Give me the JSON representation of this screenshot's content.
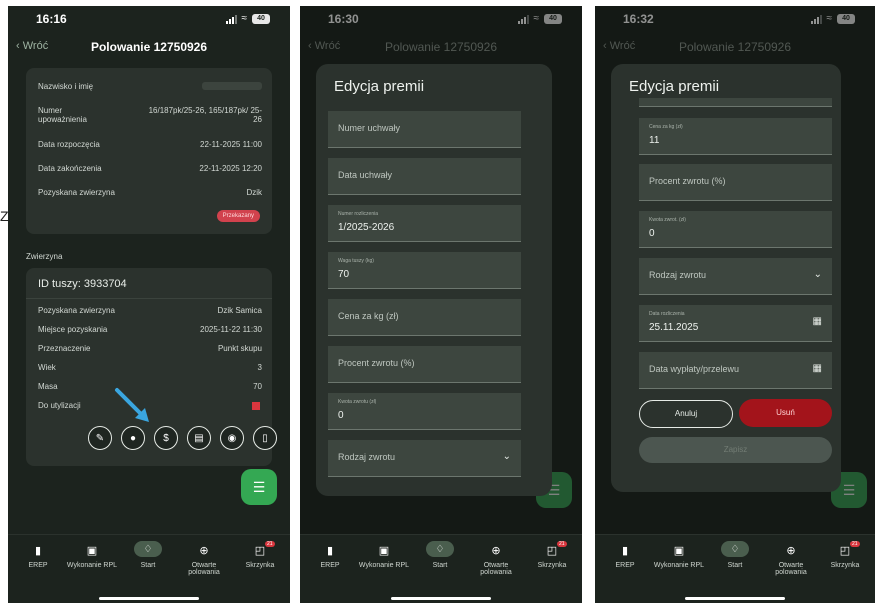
{
  "status": {
    "time1": "16:16",
    "time2": "16:30",
    "time3": "16:32",
    "battery": "40"
  },
  "nav": {
    "back": "Wróć",
    "title": "Polowanie 12750926"
  },
  "screen1": {
    "info": [
      {
        "k": "Nazwisko i imię",
        "v": ""
      },
      {
        "k": "Numer upoważnienia",
        "v": "16/187pk/25-26, 165/187pk/ 25-26"
      },
      {
        "k": "Data rozpoczęcia",
        "v": "22-11-2025 11:00"
      },
      {
        "k": "Data zakończenia",
        "v": "22-11-2025 12:20"
      },
      {
        "k": "Pozyskana zwierzyna",
        "v": "Dzik"
      }
    ],
    "badge": "Przekazany",
    "section": "Zwierzyna",
    "carcass_id": "ID tuszy: 3933704",
    "carcass": [
      {
        "k": "Pozyskana zwierzyna",
        "v": "Dzik Samica"
      },
      {
        "k": "Miejsce pozyskania",
        "v": "2025-11-22 11:30"
      },
      {
        "k": "Przeznaczenie",
        "v": "Punkt skupu"
      },
      {
        "k": "Wiek",
        "v": "3"
      },
      {
        "k": "Masa",
        "v": "70"
      },
      {
        "k": "Do utylizacji",
        "v": ""
      }
    ],
    "left_letter": "Z"
  },
  "actions": [
    "edit-icon",
    "location-icon",
    "dollar-icon",
    "document-edit-icon",
    "camera-icon",
    "trash-icon"
  ],
  "tabs": [
    {
      "label": "EREP",
      "icon": "book-icon"
    },
    {
      "label": "Wykonanie RPL",
      "icon": "calendar-check-icon"
    },
    {
      "label": "Start",
      "icon": "tree-icon"
    },
    {
      "label": "Otwarte polowania",
      "icon": "crosshair-icon"
    },
    {
      "label": "Skrzynka",
      "icon": "inbox-icon",
      "badge": "21"
    }
  ],
  "sheet2": {
    "title": "Edycja premii",
    "fields": [
      {
        "placeholder": "Numer uchwały"
      },
      {
        "placeholder": "Data uchwały"
      },
      {
        "label": "Numer rozliczenia",
        "value": "1/2025-2026"
      },
      {
        "label": "Waga tuszy (kg)",
        "value": "70"
      },
      {
        "placeholder": "Cena za kg (zł)"
      },
      {
        "placeholder": "Procent zwrotu (%)"
      },
      {
        "label": "Kwota zwrotu (zł)",
        "value": "0"
      },
      {
        "placeholder": "Rodzaj zwrotu"
      }
    ]
  },
  "sheet3": {
    "title": "Edycja premii",
    "fields": [
      {
        "label": "Cena za kg (zł)",
        "value": "11"
      },
      {
        "placeholder": "Procent zwrotu (%)"
      },
      {
        "label": "Kwota zwrot. (zł)",
        "value": "0"
      },
      {
        "placeholder": "Rodzaj zwrotu"
      },
      {
        "label": "Data rozliczenia",
        "value": "25.11.2025"
      },
      {
        "placeholder": "Data wypłaty/przelewu"
      }
    ],
    "cancel": "Anuluj",
    "delete": "Usuń",
    "save": "Zapisz"
  }
}
